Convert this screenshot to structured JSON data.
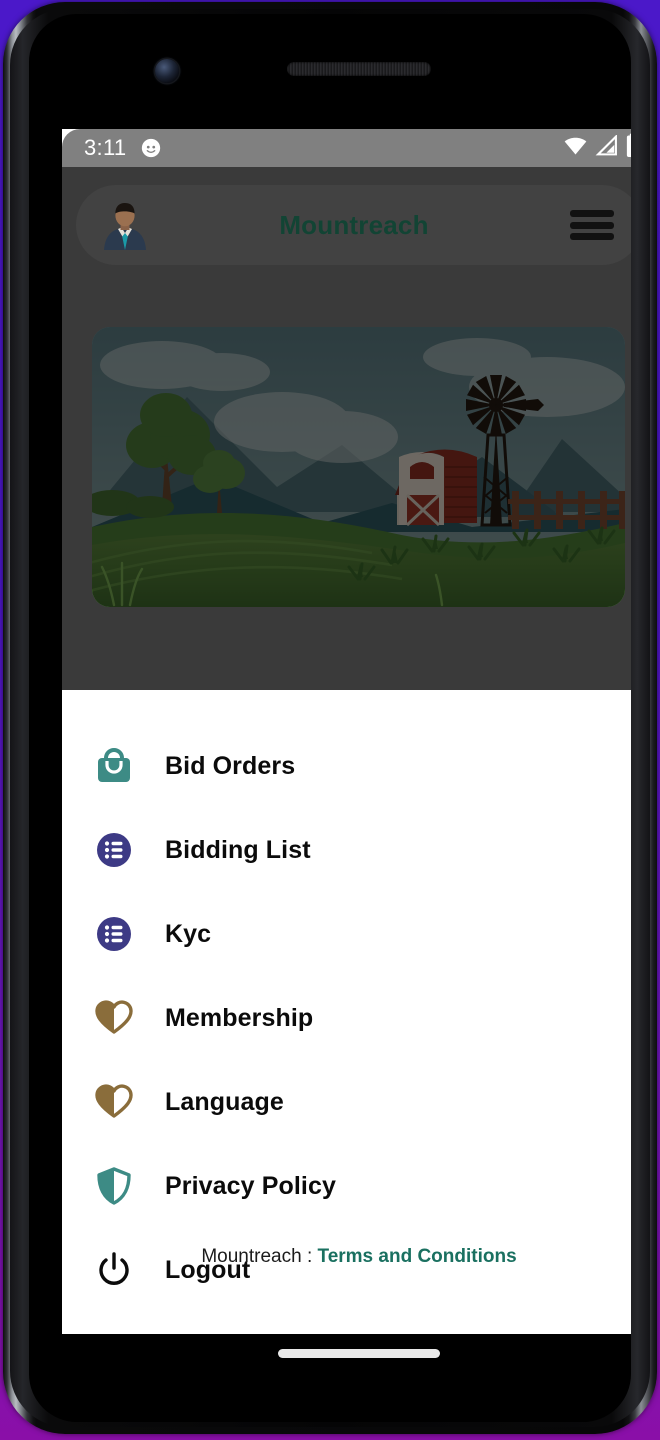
{
  "status_bar": {
    "time": "3:11",
    "emoji_icon": "cat-face-icon",
    "wifi_icon": "wifi-icon",
    "signal_icon": "cellular-signal-icon",
    "battery_icon": "battery-full-icon"
  },
  "app_bar": {
    "title": "Mountreach",
    "title_color": "#124434",
    "avatar_icon": "user-avatar-icon",
    "menu_icon": "hamburger-menu-icon"
  },
  "banner": {
    "illustration": "farm-landscape-illustration",
    "alt": "Farm landscape with barn, windmill, windpump, trees and green fields"
  },
  "drawer": {
    "items": [
      {
        "label": "Bid Orders",
        "icon": "shopping-bag-icon",
        "color": "#3d8b85"
      },
      {
        "label": "Bidding List",
        "icon": "list-circle-icon",
        "color": "#3d3a85"
      },
      {
        "label": "Kyc",
        "icon": "list-circle-icon",
        "color": "#3d3a85"
      },
      {
        "label": "Membership",
        "icon": "heart-icon",
        "color": "#8a6d3b"
      },
      {
        "label": "Language",
        "icon": "heart-icon",
        "color": "#8a6d3b"
      },
      {
        "label": "Privacy Policy",
        "icon": "shield-icon",
        "color": "#3d8b85"
      },
      {
        "label": "Logout",
        "icon": "power-icon",
        "color": "#0b0b0b"
      }
    ],
    "footer_prefix": "Mountreach : ",
    "footer_link": "Terms and Conditions"
  },
  "device": {
    "home_indicator": "home-indicator",
    "camera_icon": "front-camera-icon",
    "speaker_icon": "earpiece-speaker-icon"
  }
}
